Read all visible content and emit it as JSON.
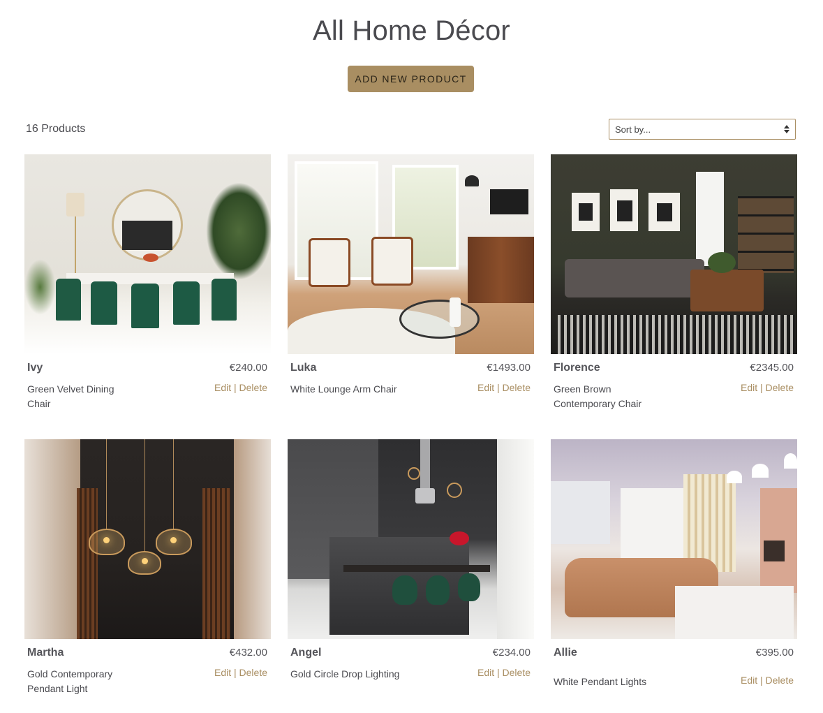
{
  "header": {
    "title": "All Home Décor",
    "add_button": "ADD NEW PRODUCT"
  },
  "toolbar": {
    "count": "16 Products",
    "sort_label": "Sort by..."
  },
  "actions": {
    "edit": "Edit",
    "separator": "|",
    "delete": "Delete"
  },
  "products": [
    {
      "name": "Ivy",
      "price": "€240.00",
      "description": "Green Velvet Dining Chair"
    },
    {
      "name": "Luka",
      "price": "€1493.00",
      "description": "White Lounge Arm Chair"
    },
    {
      "name": "Florence",
      "price": "€2345.00",
      "description": "Green Brown Contemporary Chair"
    },
    {
      "name": "Martha",
      "price": "€432.00",
      "description": "Gold Contemporary Pendant Light"
    },
    {
      "name": "Angel",
      "price": "€234.00",
      "description": "Gold Circle Drop Lighting"
    },
    {
      "name": "Allie",
      "price": "€395.00",
      "description": "White Pendant Lights"
    }
  ],
  "colors": {
    "accent": "#a98e62",
    "text": "#4a4a4f"
  }
}
